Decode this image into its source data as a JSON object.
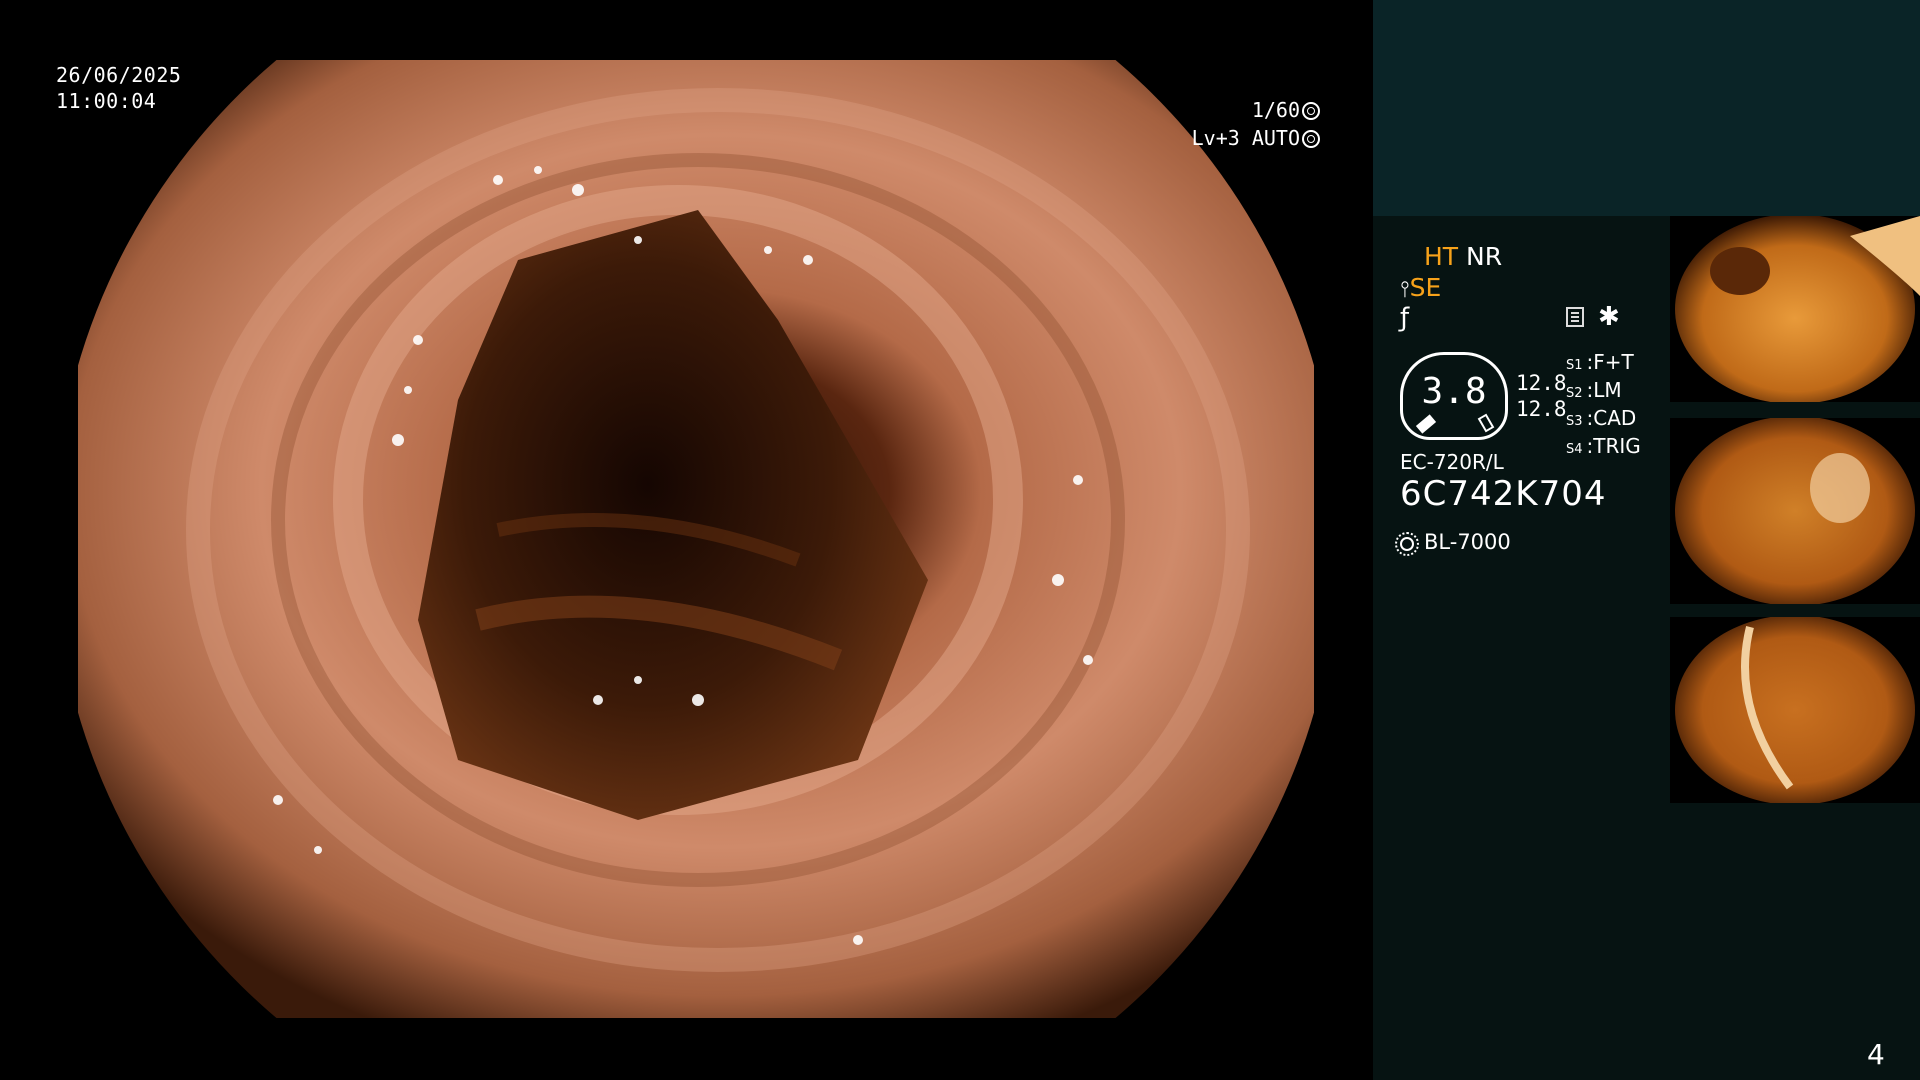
{
  "overlay": {
    "date": "26/06/2025",
    "time": "11:00:04",
    "shutter": "1/60",
    "level": "Lv+3 AUTO"
  },
  "settings": {
    "ht": "HT",
    "nr": "NR",
    "se": "SE",
    "zoom": "3.8",
    "zoom_values": [
      "12.8",
      "12.8"
    ],
    "switches": [
      {
        "id": "S1",
        "value": "F+T"
      },
      {
        "id": "S2",
        "value": "LM"
      },
      {
        "id": "S3",
        "value": "CAD"
      },
      {
        "id": "S4",
        "value": "TRIG"
      }
    ],
    "scope_model": "EC-720R/L",
    "serial": "6C742K704",
    "light_source": "BL-7000"
  },
  "page_number": "4",
  "colors": {
    "accent_orange": "#f7a21a",
    "panel_top": "#0a2427",
    "panel_body": "#061312"
  },
  "icons": [
    "shutter-icon",
    "auto-iris-icon",
    "menu-icon",
    "star-icon",
    "light-source-icon"
  ],
  "thumbnails_count": 3
}
